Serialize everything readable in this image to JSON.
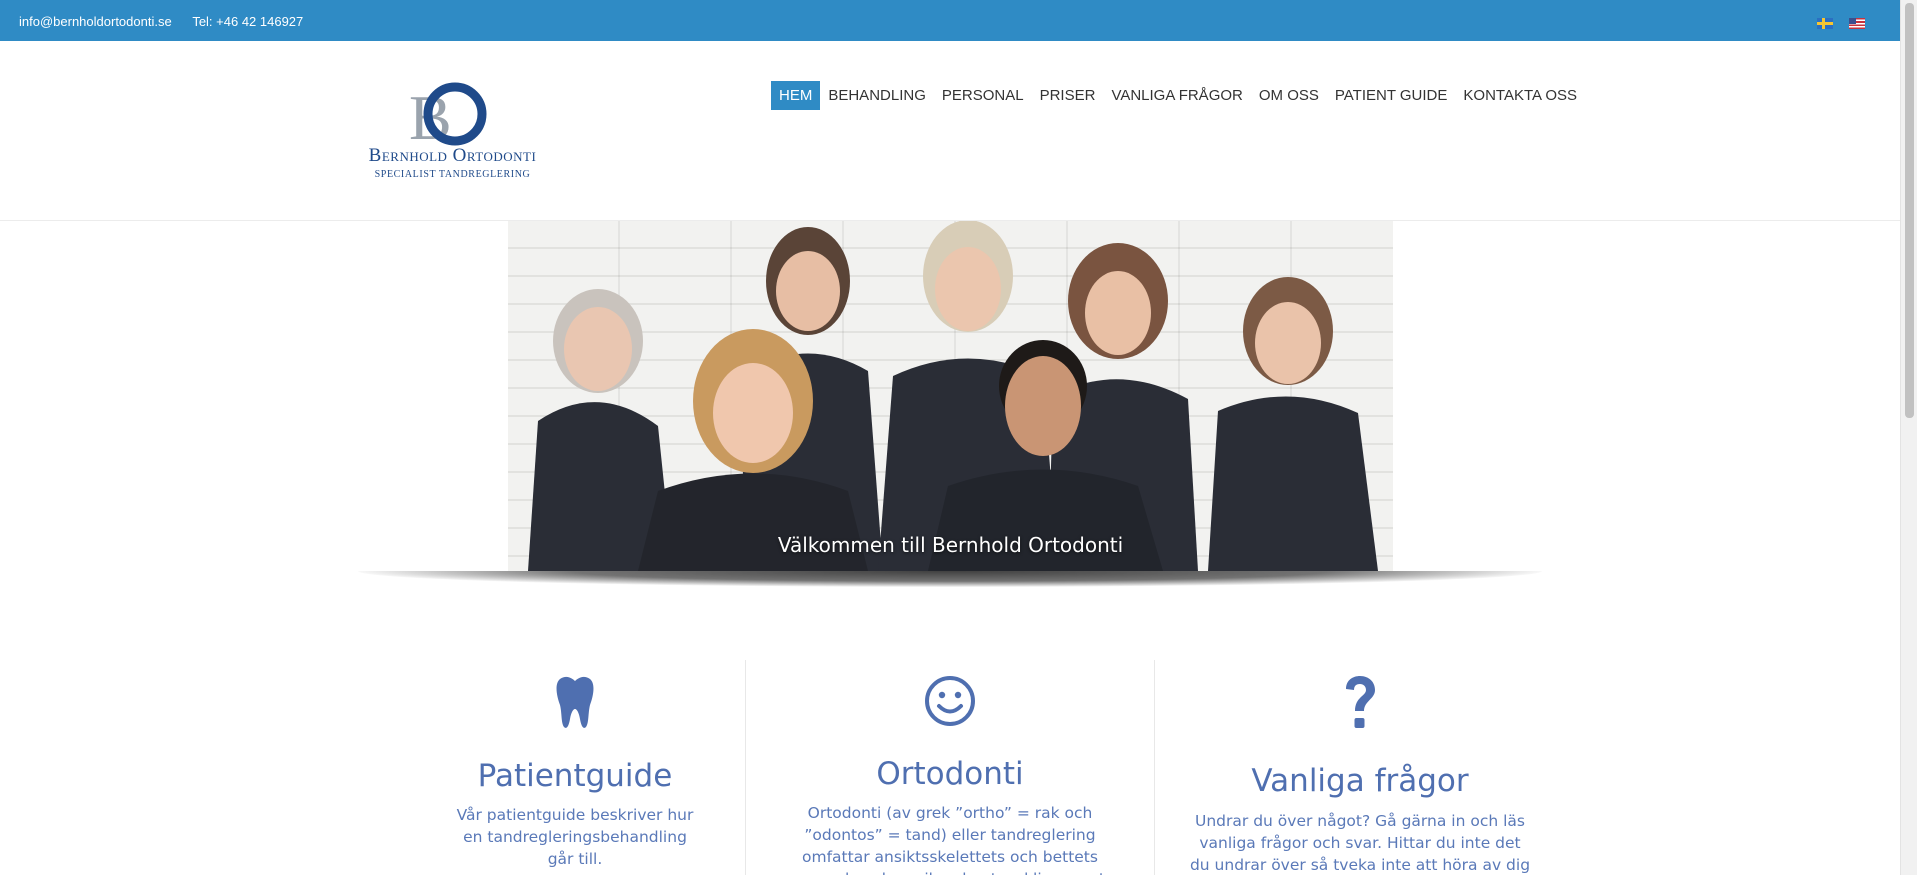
{
  "topbar": {
    "email": "info@bernholdortodonti.se",
    "phone": "Tel: +46 42 146927",
    "languages": [
      "flag-sweden-icon",
      "flag-usa-icon"
    ]
  },
  "logo": {
    "monogram": "BO",
    "brand": "Bernhold Ortodonti",
    "tagline": "SPECIALIST TANDREGLERING"
  },
  "nav": {
    "items": [
      {
        "label": "HEM",
        "active": true
      },
      {
        "label": "BEHANDLING"
      },
      {
        "label": "PERSONAL"
      },
      {
        "label": "PRISER"
      },
      {
        "label": "VANLIGA FRÅGOR"
      },
      {
        "label": "OM OSS"
      },
      {
        "label": "PATIENT GUIDE"
      },
      {
        "label": "KONTAKTA OSS"
      }
    ]
  },
  "hero": {
    "caption": "Välkommen till Bernhold Ortodonti"
  },
  "features": [
    {
      "icon": "tooth-icon",
      "title": "Patientguide",
      "text": "Vår patientguide beskriver hur en tandregleringsbehandling går till."
    },
    {
      "icon": "smiley-icon",
      "title": "Ortodonti",
      "text": "Ortodonti (av grek ”ortho” = rak och ”odontos” = tand) eller tandreglering omfattar ansiktsskelettets och bettets normala och avvikande utveckling samt behandling av"
    },
    {
      "icon": "question-icon",
      "title": "Vanliga frågor",
      "text": "Undrar du över något? Gå gärna in och läs vanliga frågor och svar. Hittar du inte det du undrar över så tveka inte att höra av dig med"
    }
  ],
  "colors": {
    "topbar": "#2f8bc5",
    "accent": "#4f6fb0",
    "logo": "#1f4a8a"
  }
}
